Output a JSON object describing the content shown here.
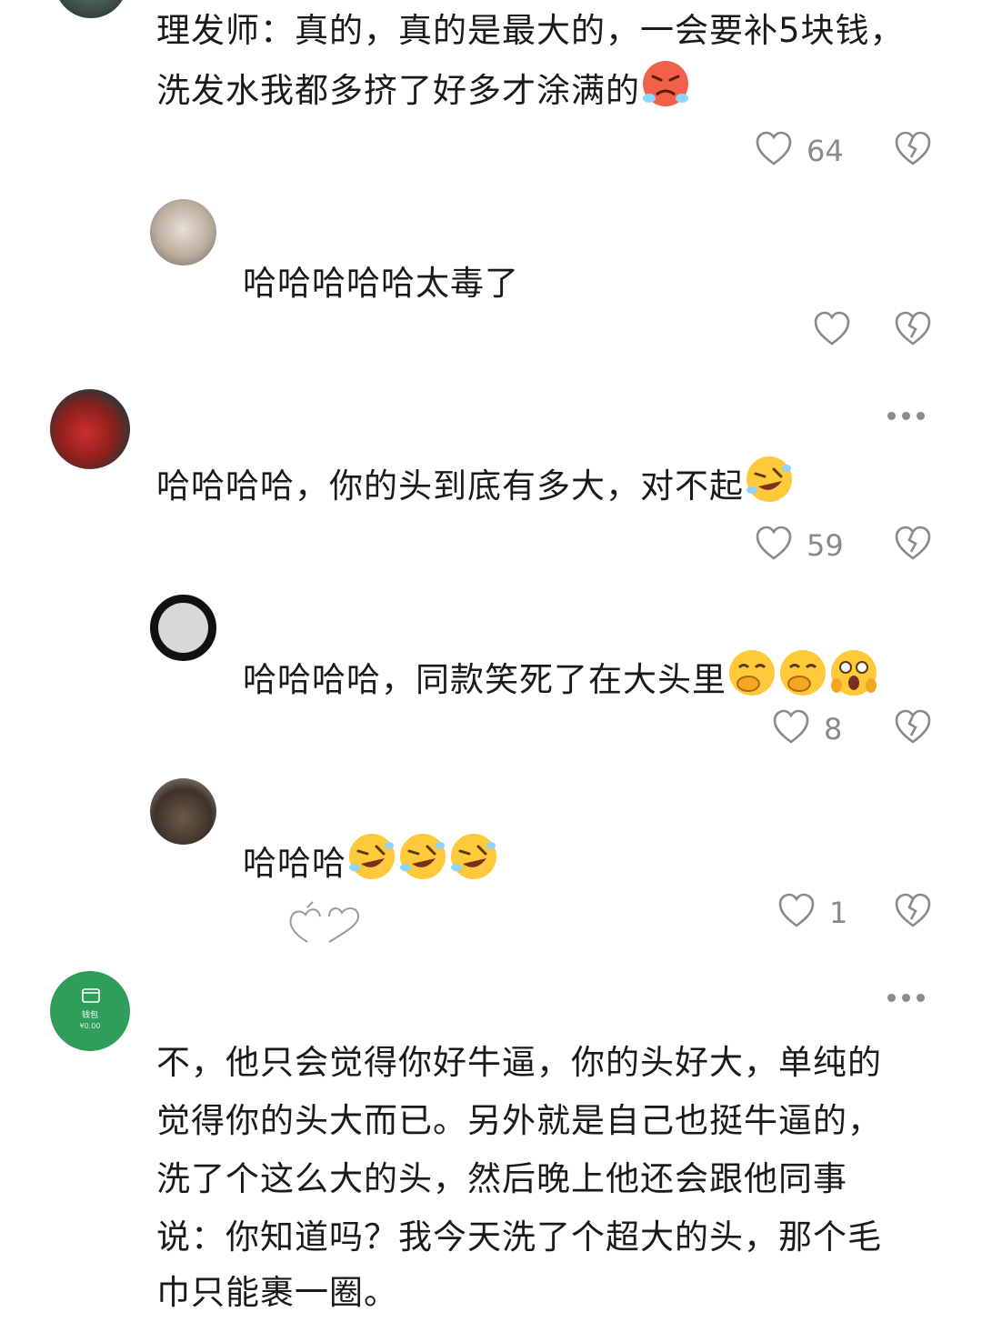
{
  "comments": [
    {
      "id": "c1",
      "lines": [
        "理发师：真的，真的是最大的，一会要补5块钱，",
        "洗发水我都多挤了好多才涂满的"
      ],
      "emojis": [
        "angry-tears-emoji"
      ],
      "likes": "64"
    },
    {
      "id": "c2",
      "lines": [
        "哈哈哈哈哈太毒了"
      ],
      "likes": ""
    },
    {
      "id": "c3",
      "lines": [
        "哈哈哈哈，你的头到底有多大，对不起"
      ],
      "emojis": [
        "rofl-emoji"
      ],
      "likes": "59"
    },
    {
      "id": "c4",
      "lines": [
        "哈哈哈哈，同款笑死了在大头里"
      ],
      "emojis": [
        "giggle-emoji",
        "giggle-emoji",
        "shocked-emoji"
      ],
      "likes": "8"
    },
    {
      "id": "c5",
      "lines": [
        "哈哈哈"
      ],
      "emojis": [
        "rofl-emoji",
        "rofl-emoji",
        "rofl-emoji"
      ],
      "likes": "1"
    },
    {
      "id": "c6",
      "lines": [
        "不，他只会觉得你好牛逼，你的头好大，单纯的",
        "觉得你的头大而已。另外就是自己也挺牛逼的，",
        "洗了个这么大的头，然后晚上他还会跟他同事",
        "说：你知道吗？我今天洗了个超大的头，那个毛",
        "巾只能裹一圈。"
      ]
    }
  ],
  "wallet_avatar": {
    "label": "钱包",
    "amount": "¥0.00"
  },
  "colors": {
    "like_gray": "#8a8a8a",
    "wallet_green": "#2f9e5b"
  }
}
